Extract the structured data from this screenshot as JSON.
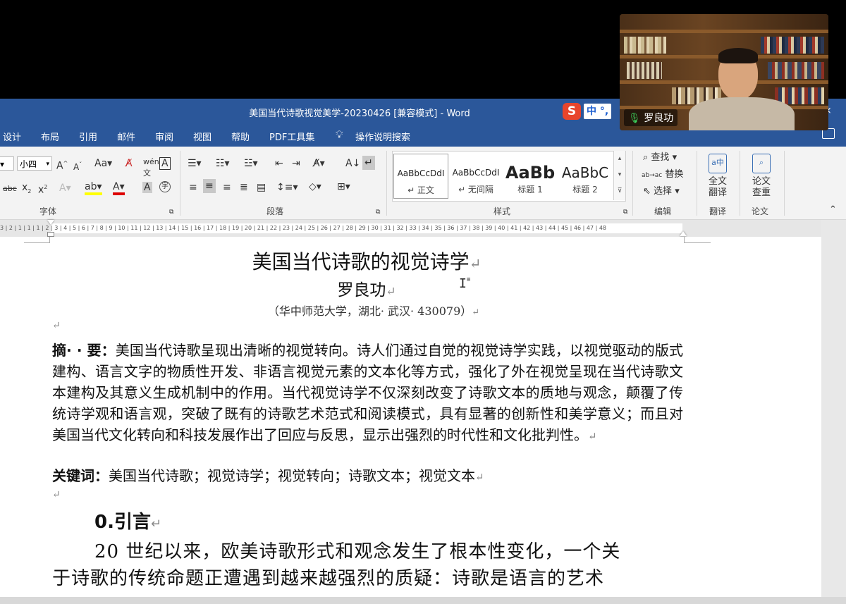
{
  "window": {
    "title": "美国当代诗歌视觉美学-20230426 [兼容模式]  -  Word",
    "ime_indicator": "中 °,",
    "restore_glyph": "‹"
  },
  "ribbon_tabs": [
    "设计",
    "布局",
    "引用",
    "邮件",
    "审阅",
    "视图",
    "帮助",
    "PDF工具集",
    "操作说明搜索"
  ],
  "ribbon": {
    "font_size_value": "小四",
    "group_labels": [
      "字体",
      "段落",
      "样式",
      "编辑",
      "翻译",
      "论文"
    ],
    "styles": [
      {
        "sample": "AaBbCcDdI",
        "name": "↵ 正文"
      },
      {
        "sample": "AaBbCcDdI",
        "name": "↵ 无间隔"
      },
      {
        "sample": "AaBb",
        "name": "标题 1"
      },
      {
        "sample": "AaBbC",
        "name": "标题 2"
      }
    ],
    "editing": {
      "find": "查找",
      "replace": "替换",
      "select": "选择"
    },
    "translate": {
      "line1": "全文",
      "line2": "翻译"
    },
    "paper": {
      "line1": "论文",
      "line2": "查重"
    }
  },
  "ruler_ticks": "3 | 2 | 1 | 1 | 1 | 2 | 3 | 4 | 5 | 6 | 7 | 8 | 9 | 10 | 11 | 12 | 13 | 14 | 15 | 16 | 17 | 18 | 19 | 20 | 21 | 22 | 23 | 24 | 25 | 26 | 27 | 28 | 29 | 30 | 31 | 32 | 33 | 34 | 35 | 36 | 37 | 38 | 39 | 40 | 41 | 42 | 43 | 44 | 45 | 46 | 47 | 48",
  "document": {
    "title": "美国当代诗歌的视觉诗学",
    "author": "罗良功",
    "affiliation": "（华中师范大学，湖北· 武汉· 430079）",
    "abstract_label": "摘· · 要：",
    "abstract_text": "美国当代诗歌呈现出清晰的视觉转向。诗人们通过自觉的视觉诗学实践，以视觉驱动的版式建构、语言文字的物质性开发、非语言视觉元素的文本化等方式，强化了外在视觉呈现在当代诗歌文本建构及其意义生成机制中的作用。当代视觉诗学不仅深刻改变了诗歌文本的质地与观念，颠覆了传统诗学观和语言观，突破了既有的诗歌艺术范式和阅读模式，具有显著的创新性和美学意义；而且对美国当代文化转向和科技发展作出了回应与反思，显示出强烈的时代性和文化批判性。",
    "keywords_label": "关键词：",
    "keywords_text": "美国当代诗歌；视觉诗学；视觉转向；诗歌文本；视觉文本",
    "section_heading": "0.引言",
    "body_line1": "20 世纪以来，欧美诗歌形式和观念发生了根本性变化，一个关",
    "body_line2": "于诗歌的传统命题正遭遇到越来越强烈的质疑：诗歌是语言的艺术",
    "para_mark": "↵"
  },
  "video": {
    "participant_name": "罗良功"
  }
}
